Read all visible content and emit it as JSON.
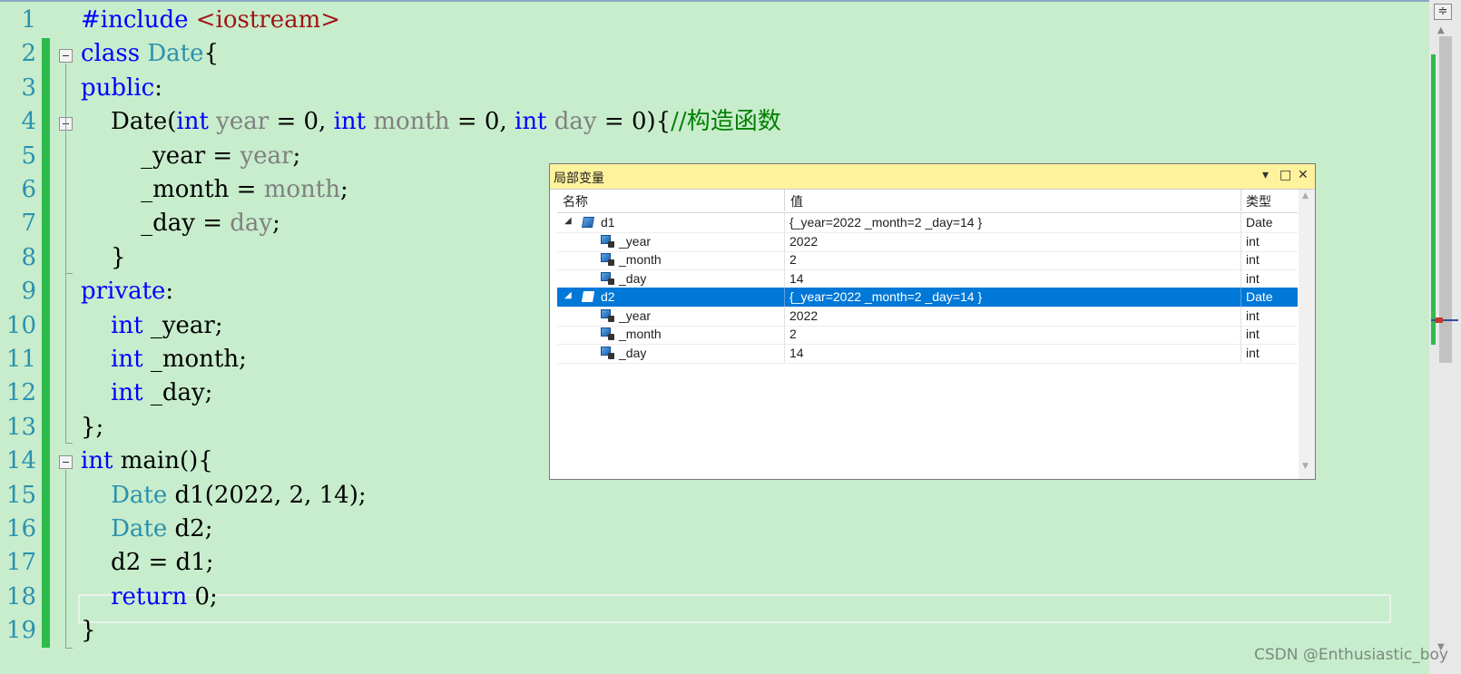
{
  "editor": {
    "line_numbers": [
      "1",
      "2",
      "3",
      "4",
      "5",
      "6",
      "7",
      "8",
      "9",
      "10",
      "11",
      "12",
      "13",
      "14",
      "15",
      "16",
      "17",
      "18",
      "19"
    ],
    "lines": [
      [
        {
          "t": "#include ",
          "c": "kw"
        },
        {
          "t": "<iostream>",
          "c": "st"
        }
      ],
      [
        {
          "t": "class ",
          "c": "kw"
        },
        {
          "t": "Date",
          "c": "ty"
        },
        {
          "t": "{",
          "c": "pl"
        }
      ],
      [
        {
          "t": "public",
          "c": "kw"
        },
        {
          "t": ":",
          "c": "pl"
        }
      ],
      [
        {
          "t": "    Date(",
          "c": "pl"
        },
        {
          "t": "int ",
          "c": "kw"
        },
        {
          "t": "year",
          "c": "pr"
        },
        {
          "t": " = 0, ",
          "c": "pl"
        },
        {
          "t": "int ",
          "c": "kw"
        },
        {
          "t": "month",
          "c": "pr"
        },
        {
          "t": " = 0, ",
          "c": "pl"
        },
        {
          "t": "int ",
          "c": "kw"
        },
        {
          "t": "day",
          "c": "pr"
        },
        {
          "t": " = 0){",
          "c": "pl"
        },
        {
          "t": "//构造函数",
          "c": "cm"
        }
      ],
      [
        {
          "t": "        _year = ",
          "c": "pl"
        },
        {
          "t": "year",
          "c": "pr"
        },
        {
          "t": ";",
          "c": "pl"
        }
      ],
      [
        {
          "t": "        _month = ",
          "c": "pl"
        },
        {
          "t": "month",
          "c": "pr"
        },
        {
          "t": ";",
          "c": "pl"
        }
      ],
      [
        {
          "t": "        _day = ",
          "c": "pl"
        },
        {
          "t": "day",
          "c": "pr"
        },
        {
          "t": ";",
          "c": "pl"
        }
      ],
      [
        {
          "t": "    }",
          "c": "pl"
        }
      ],
      [
        {
          "t": "private",
          "c": "kw"
        },
        {
          "t": ":",
          "c": "pl"
        }
      ],
      [
        {
          "t": "    ",
          "c": "pl"
        },
        {
          "t": "int",
          "c": "kw"
        },
        {
          "t": " _year;",
          "c": "pl"
        }
      ],
      [
        {
          "t": "    ",
          "c": "pl"
        },
        {
          "t": "int",
          "c": "kw"
        },
        {
          "t": " _month;",
          "c": "pl"
        }
      ],
      [
        {
          "t": "    ",
          "c": "pl"
        },
        {
          "t": "int",
          "c": "kw"
        },
        {
          "t": " _day;",
          "c": "pl"
        }
      ],
      [
        {
          "t": "};",
          "c": "pl"
        }
      ],
      [
        {
          "t": "int",
          "c": "kw"
        },
        {
          "t": " main(){",
          "c": "pl"
        }
      ],
      [
        {
          "t": "    ",
          "c": "pl"
        },
        {
          "t": "Date",
          "c": "ty"
        },
        {
          "t": " d1(2022, 2, 14);",
          "c": "pl"
        }
      ],
      [
        {
          "t": "    ",
          "c": "pl"
        },
        {
          "t": "Date",
          "c": "ty"
        },
        {
          "t": " d2;",
          "c": "pl"
        }
      ],
      [
        {
          "t": "    d2 = d1;",
          "c": "pl"
        }
      ],
      [
        {
          "t": "    ",
          "c": "pl"
        },
        {
          "t": "return",
          "c": "kw"
        },
        {
          "t": " 0;",
          "c": "pl"
        }
      ],
      [
        {
          "t": "}",
          "c": "pl"
        }
      ]
    ],
    "colors": {
      "background": "#c7edcc",
      "keyword": "#0000ff",
      "type": "#2b91af",
      "param": "#808080",
      "string": "#a31515",
      "comment": "#008000",
      "change_bar": "#2dbb4b"
    }
  },
  "locals": {
    "title": "局部变量",
    "buttons": {
      "dropdown": "▾",
      "maximize": "□",
      "close": "✕"
    },
    "columns": {
      "name": "名称",
      "value": "值",
      "type": "类型"
    },
    "rows": [
      {
        "level": 0,
        "expander": "◢",
        "icon": "object-icon",
        "name": "d1",
        "value": "{_year=2022 _month=2 _day=14 }",
        "type": "Date",
        "selected": false
      },
      {
        "level": 1,
        "icon": "field-icon",
        "name": "_year",
        "value": "2022",
        "type": "int",
        "selected": false
      },
      {
        "level": 1,
        "icon": "field-icon",
        "name": "_month",
        "value": "2",
        "type": "int",
        "selected": false
      },
      {
        "level": 1,
        "icon": "field-icon",
        "name": "_day",
        "value": "14",
        "type": "int",
        "selected": false
      },
      {
        "level": 0,
        "expander": "◢",
        "icon": "object-icon",
        "name": "d2",
        "value": "{_year=2022 _month=2 _day=14 }",
        "type": "Date",
        "selected": true
      },
      {
        "level": 1,
        "icon": "field-icon",
        "name": "_year",
        "value": "2022",
        "type": "int",
        "selected": false
      },
      {
        "level": 1,
        "icon": "field-icon",
        "name": "_month",
        "value": "2",
        "type": "int",
        "selected": false
      },
      {
        "level": 1,
        "icon": "field-icon",
        "name": "_day",
        "value": "14",
        "type": "int",
        "selected": false
      }
    ],
    "colors": {
      "title_bar": "#fff29d",
      "selection": "#0078d7"
    }
  },
  "scrollbar": {
    "split_icon": "≑",
    "up_arrow": "▲",
    "down_arrow": "▼"
  },
  "watermark": "CSDN @Enthusiastic_boy"
}
